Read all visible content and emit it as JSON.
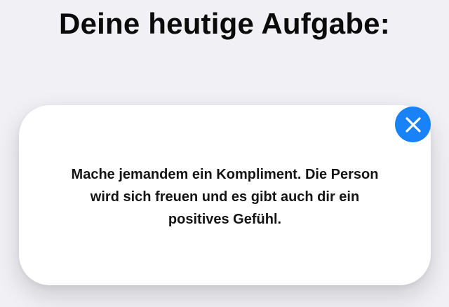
{
  "header": {
    "title": "Deine heutige Aufgabe:"
  },
  "task_card": {
    "text": "Mache jemandem ein Kompliment. Die Person wird sich freuen und es gibt auch dir ein positives Gefühl."
  },
  "close_button": {
    "icon": "close-icon",
    "color": "#1a82f7"
  }
}
